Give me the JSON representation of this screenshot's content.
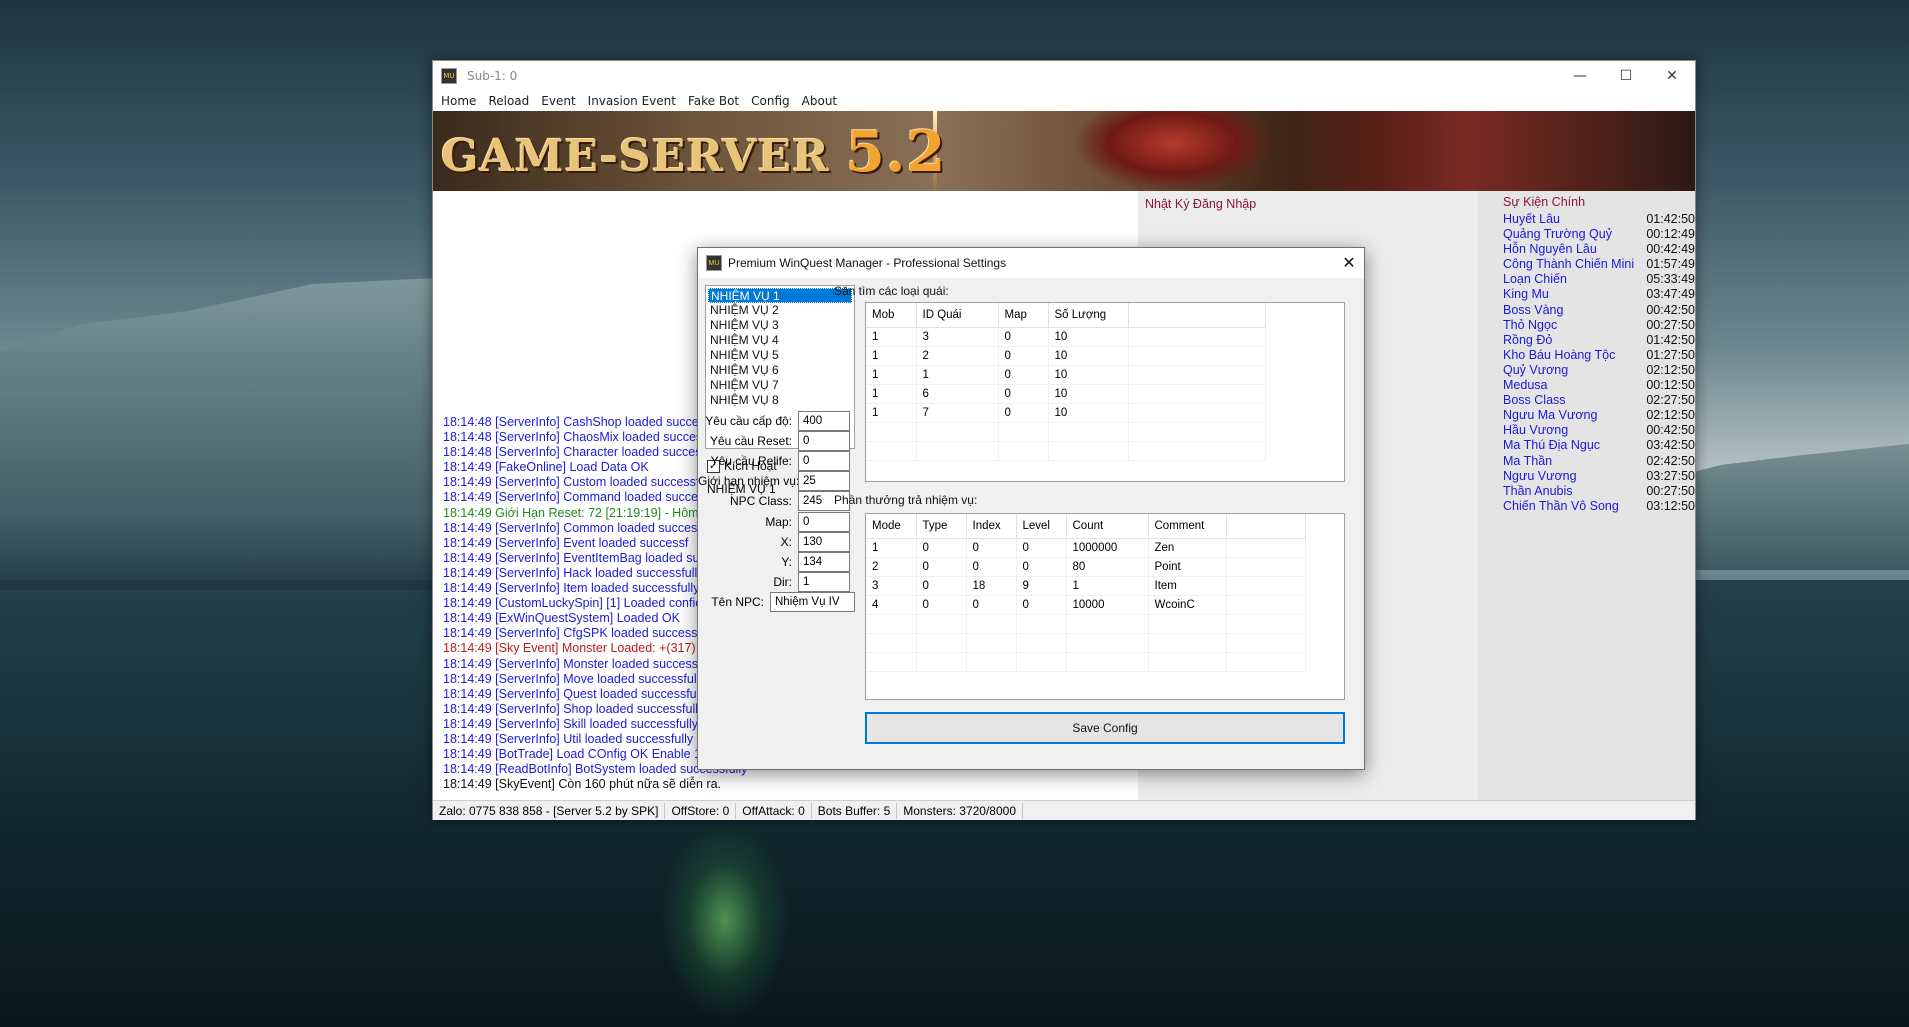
{
  "window": {
    "title": "Sub-1: 0",
    "icon_text": "MU",
    "controls": {
      "minimize": "—",
      "maximize": "☐",
      "close": "✕"
    }
  },
  "menu": [
    "Home",
    "Reload",
    "Event",
    "Invasion Event",
    "Fake Bot",
    "Config",
    "About"
  ],
  "banner": {
    "logo_text": "GAME-SERVER",
    "logo_version": "5.2"
  },
  "log": [
    {
      "text": "18:14:48 [ServerInfo] CashShop loaded succes",
      "color": "blue"
    },
    {
      "text": "18:14:48 [ServerInfo] ChaosMix loaded succes",
      "color": "blue"
    },
    {
      "text": "18:14:48 [ServerInfo] Character loaded succes",
      "color": "blue"
    },
    {
      "text": "18:14:49 [FakeOnline] Load Data OK",
      "color": "blue"
    },
    {
      "text": "18:14:49 [ServerInfo] Custom loaded successf",
      "color": "blue"
    },
    {
      "text": "18:14:49 [ServerInfo] Command loaded succes",
      "color": "blue"
    },
    {
      "text": "18:14:49 Giới Hạn Reset: 72 [21:19:19] - Hôm n",
      "color": "green"
    },
    {
      "text": "18:14:49 [ServerInfo] Common loaded succes",
      "color": "blue"
    },
    {
      "text": "18:14:49 [ServerInfo] Event loaded successf",
      "color": "blue"
    },
    {
      "text": "18:14:49 [ServerInfo] EventItemBag loaded su",
      "color": "blue"
    },
    {
      "text": "18:14:49 [ServerInfo] Hack loaded successfully",
      "color": "blue"
    },
    {
      "text": "18:14:49 [ServerInfo] Item loaded successfully",
      "color": "blue"
    },
    {
      "text": "18:14:49 [CustomLuckySpin] [1] Loaded confic",
      "color": "blue"
    },
    {
      "text": "18:14:49 [ExWinQuestSystem] Loaded OK",
      "color": "blue"
    },
    {
      "text": "18:14:49 [ServerInfo] CfgSPK loaded successf",
      "color": "blue"
    },
    {
      "text": "18:14:49 [Sky Event] Monster Loaded: +(317)",
      "color": "red"
    },
    {
      "text": "18:14:49 [ServerInfo] Monster loaded success",
      "color": "blue"
    },
    {
      "text": "18:14:49 [ServerInfo] Move loaded successfull",
      "color": "blue"
    },
    {
      "text": "18:14:49 [ServerInfo] Quest loaded successfull",
      "color": "blue"
    },
    {
      "text": "18:14:49 [ServerInfo] Shop loaded successfully",
      "color": "blue"
    },
    {
      "text": "18:14:49 [ServerInfo] Skill loaded successfully",
      "color": "blue"
    },
    {
      "text": "18:14:49 [ServerInfo] Util loaded successfully",
      "color": "blue"
    },
    {
      "text": "18:14:49 [BotTrade] Load COnfig OK Enable 1",
      "color": "blue"
    },
    {
      "text": "18:14:49 [ReadBotInfo] BotSystem loaded successfully",
      "color": "blue"
    },
    {
      "text": "18:14:49 [SkyEvent] Còn 160 phút nữa sẽ diễn ra.",
      "color": "black"
    }
  ],
  "login_panel": {
    "title": "Nhật Ký Đăng Nhập"
  },
  "events_panel": {
    "title": "Sự Kiện Chính",
    "events": [
      {
        "name": "Huyết Lâu",
        "time": "01:42:50"
      },
      {
        "name": "Quảng Trường Quỷ",
        "time": "00:12:49"
      },
      {
        "name": "Hỗn Nguyên Lâu",
        "time": "00:42:49"
      },
      {
        "name": "Công Thành Chiến Mini",
        "time": "01:57:49"
      },
      {
        "name": "Loạn Chiến",
        "time": "05:33:49"
      },
      {
        "name": "King Mu",
        "time": "03:47:49"
      },
      {
        "name": "Boss Vàng",
        "time": "00:42:50"
      },
      {
        "name": "Thỏ Ngọc",
        "time": "00:27:50"
      },
      {
        "name": "Rồng Đỏ",
        "time": "01:42:50"
      },
      {
        "name": "Kho Báu Hoàng Tộc",
        "time": "01:27:50"
      },
      {
        "name": "Quỷ Vương",
        "time": "02:12:50"
      },
      {
        "name": "Medusa",
        "time": "00:12:50"
      },
      {
        "name": "Boss Class",
        "time": "02:27:50"
      },
      {
        "name": "Ngưu Ma Vương",
        "time": "02:12:50"
      },
      {
        "name": "Hầu Vương",
        "time": "00:42:50"
      },
      {
        "name": "Ma Thú Địa Ngục",
        "time": "03:42:50"
      },
      {
        "name": "Ma Thần",
        "time": "02:42:50"
      },
      {
        "name": "Ngưu Vương",
        "time": "03:27:50"
      },
      {
        "name": "Thần Anubis",
        "time": "00:27:50"
      },
      {
        "name": "Chiến Thần Vô Song",
        "time": "03:12:50"
      }
    ]
  },
  "statusbar": [
    "Zalo: 0775 838 858 - [Server 5.2 by SPK]",
    "OffStore: 0",
    "OffAttack: 0",
    "Bots Buffer: 5",
    "Monsters: 3720/8000"
  ],
  "dialog": {
    "title": "Premium WinQuest Manager - Professional Settings",
    "close": "✕",
    "quests": [
      "NHIỆM VỤ 1",
      "NHIỆM VỤ 2",
      "NHIỆM VỤ 3",
      "NHIỆM VỤ 4",
      "NHIỆM VỤ 5",
      "NHIỆM VỤ 6",
      "NHIỆM VỤ 7",
      "NHIỆM VỤ 8"
    ],
    "selected_quest_index": 0,
    "active_checkbox": {
      "label": "Kích Hoạt",
      "checked": true,
      "mark": "✓"
    },
    "current_quest_label": "NHIỆM VỤ 1",
    "fields": [
      {
        "label": "Yêu cầu cấp độ:",
        "value": "400"
      },
      {
        "label": "Yêu cầu Reset:",
        "value": "0"
      },
      {
        "label": "Yêu cầu Relife:",
        "value": "0"
      },
      {
        "label": "Giới hạn nhiệm vụ:",
        "value": "25"
      },
      {
        "label": "NPC Class:",
        "value": "245"
      },
      {
        "label": "Map:",
        "value": "0"
      },
      {
        "label": "X:",
        "value": "130"
      },
      {
        "label": "Y:",
        "value": "134"
      },
      {
        "label": "Dir:",
        "value": "1"
      }
    ],
    "npc_name": {
      "label": "Tên NPC:",
      "value": "Nhiệm Vụ IV"
    },
    "mob_section": {
      "label": "Săn tìm các loại quái:",
      "columns": [
        "Mob",
        "ID Quái",
        "Map",
        "Số Lượng",
        ""
      ],
      "rows": [
        [
          "1",
          "3",
          "0",
          "10",
          ""
        ],
        [
          "1",
          "2",
          "0",
          "10",
          ""
        ],
        [
          "1",
          "1",
          "0",
          "10",
          ""
        ],
        [
          "1",
          "6",
          "0",
          "10",
          ""
        ],
        [
          "1",
          "7",
          "0",
          "10",
          ""
        ],
        [
          "",
          "",
          "",
          "",
          ""
        ],
        [
          "",
          "",
          "",
          "",
          ""
        ]
      ]
    },
    "reward_section": {
      "label": "Phần thưởng trả nhiệm vụ:",
      "columns": [
        "Mode",
        "Type",
        "Index",
        "Level",
        "Count",
        "Comment",
        ""
      ],
      "rows": [
        [
          "1",
          "0",
          "0",
          "0",
          "1000000",
          "Zen",
          ""
        ],
        [
          "2",
          "0",
          "0",
          "0",
          "80",
          "Point",
          ""
        ],
        [
          "3",
          "0",
          "18",
          "9",
          "1",
          "Item",
          ""
        ],
        [
          "4",
          "0",
          "0",
          "0",
          "10000",
          "WcoinC",
          ""
        ],
        [
          "",
          "",
          "",
          "",
          "",
          "",
          ""
        ],
        [
          "",
          "",
          "",
          "",
          "",
          "",
          ""
        ],
        [
          "",
          "",
          "",
          "",
          "",
          "",
          ""
        ]
      ]
    },
    "save_button": "Save Config"
  }
}
